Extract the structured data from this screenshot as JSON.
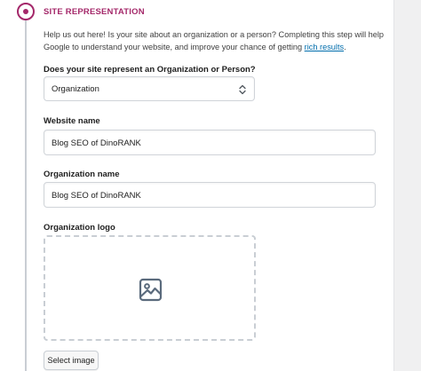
{
  "step": {
    "title": "SITE REPRESENTATION",
    "intro_text": "Help us out here! Is your site about an organization or a person? Completing this step will help Google to understand your website, and improve your chance of getting ",
    "intro_link": "rich results",
    "intro_end": "."
  },
  "representation": {
    "label": "Does your site represent an Organization or Person?",
    "selected": "Organization"
  },
  "website_name": {
    "label": "Website name",
    "value": "Blog SEO of DinoRANK"
  },
  "organization_name": {
    "label": "Organization name",
    "value": "Blog SEO of DinoRANK"
  },
  "organization_logo": {
    "label": "Organization logo",
    "icon": "image-icon",
    "button_label": "Select image"
  },
  "colors": {
    "accent": "#a4286a",
    "link": "#006dac",
    "border": "#d0d4d9"
  }
}
